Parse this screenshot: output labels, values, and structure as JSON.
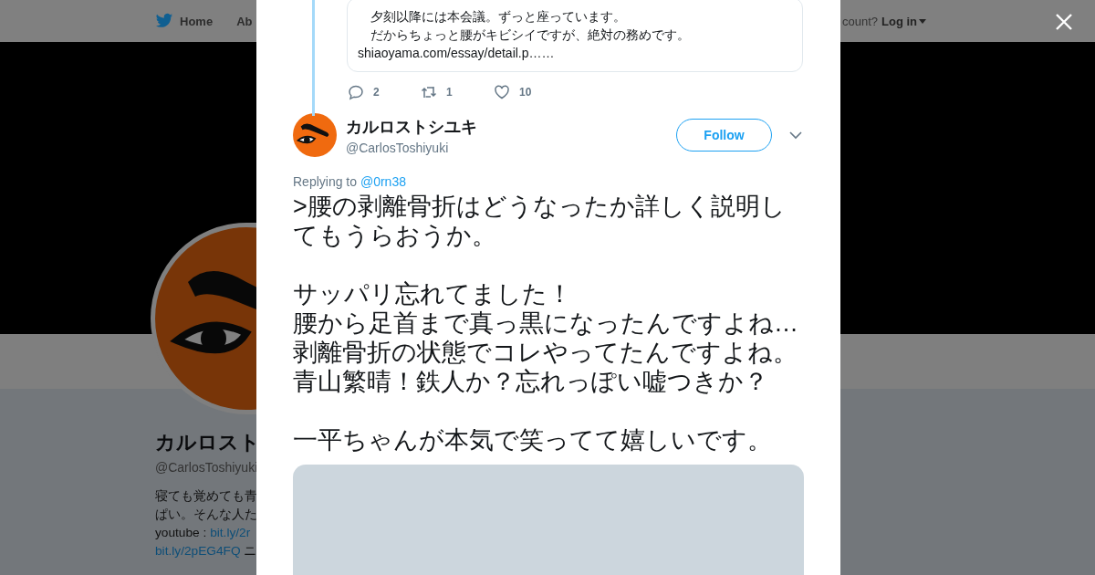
{
  "nav": {
    "items": [
      {
        "label": "Home"
      },
      {
        "label": "Ab"
      }
    ],
    "account_prompt": "count?",
    "login": "Log in"
  },
  "profile": {
    "name": "カルロスト",
    "handle": "@CarlosToshiyuki",
    "bio": [
      {
        "text": "寝ても覚めても青"
      },
      {
        "text": "ぱい。そんな人た"
      },
      {
        "text": "youtube : ",
        "link": "bit.ly/2r"
      },
      {
        "link": "bit.ly/2pEG4FQ",
        "text": " ニ"
      }
    ]
  },
  "modal": {
    "quoted_tweet": {
      "lines": [
        "　夕刻以降には本会議。ずっと座っています。",
        "　だからちょっと腰がキビシイですが、絶対の務めです。"
      ],
      "link": "shiaoyama.com/essay/detail.p……"
    },
    "parent_actions": {
      "replies": "2",
      "retweets": "1",
      "likes": "10"
    },
    "tweet": {
      "name": "カルロストシユキ",
      "handle": "@CarlosToshiyuki",
      "follow_label": "Follow",
      "replying_prefix": "Replying to",
      "replying_to": "@0rn38",
      "paragraphs": [
        [
          ">腰の剥離骨折はどうなったか詳しく説明してもうらおうか。"
        ],
        [
          "サッパリ忘れてました！",
          "腰から足首まで真っ黒になったんですよね…",
          "剥離骨折の状態でコレやってたんですよね。",
          "青山繁晴！鉄人か？忘れっぽい嘘つきか？"
        ],
        [
          "一平ちゃんが本気で笑ってて嬉しいです。"
        ]
      ]
    }
  }
}
